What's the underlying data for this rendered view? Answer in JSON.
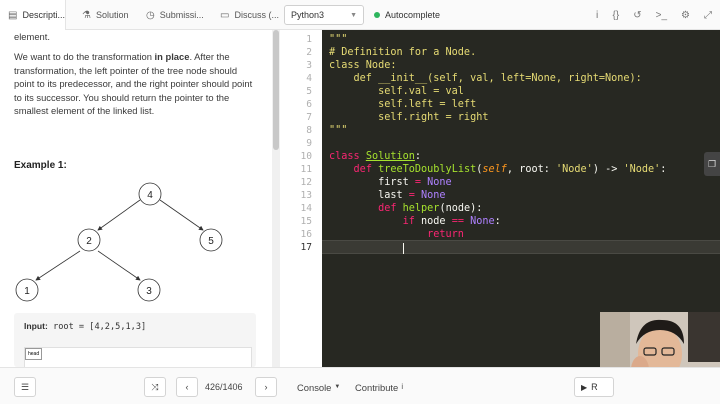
{
  "tabs": [
    {
      "label": "Descripti...",
      "icon": "document-icon"
    },
    {
      "label": "Solution",
      "icon": "flask-icon"
    },
    {
      "label": "Submissi...",
      "icon": "clock-icon"
    },
    {
      "label": "Discuss (...",
      "icon": "comments-icon"
    }
  ],
  "editor_header": {
    "language": "Python3",
    "autocomplete_label": "Autocomplete",
    "autocomplete_status_color": "#2db55d"
  },
  "toolbar_icons": [
    "info-icon",
    "braces-icon",
    "reset-icon",
    "terminal-icon",
    "settings-icon",
    "fullscreen-icon"
  ],
  "description": {
    "top_text": "element.",
    "para_prefix": "We want to do the transformation ",
    "para_bold": "in place",
    "para_rest": ". After the transformation, the left pointer of the tree node should point to its predecessor, and the right pointer should point to its successor. You should return the pointer to the smallest element of the linked list.",
    "example_title": "Example 1:",
    "tree_nodes": [
      "4",
      "2",
      "5",
      "1",
      "3"
    ],
    "input_label": "Input:",
    "input_value": "root = [4,2,5,1,3]",
    "thumb_label": "head"
  },
  "code": {
    "line_numbers": [
      "1",
      "2",
      "3",
      "4",
      "5",
      "6",
      "7",
      "8",
      "9",
      "10",
      "11",
      "12",
      "13",
      "14",
      "15",
      "16",
      "17"
    ],
    "current_line": 17
  },
  "bottom": {
    "list_icon": "list-icon",
    "shuffle_icon": "shuffle-icon",
    "prev_label": "‹",
    "next_label": "›",
    "pager": "426/1406",
    "console_label": "Console",
    "contribute_label": "Contribute",
    "run_label": "R"
  }
}
